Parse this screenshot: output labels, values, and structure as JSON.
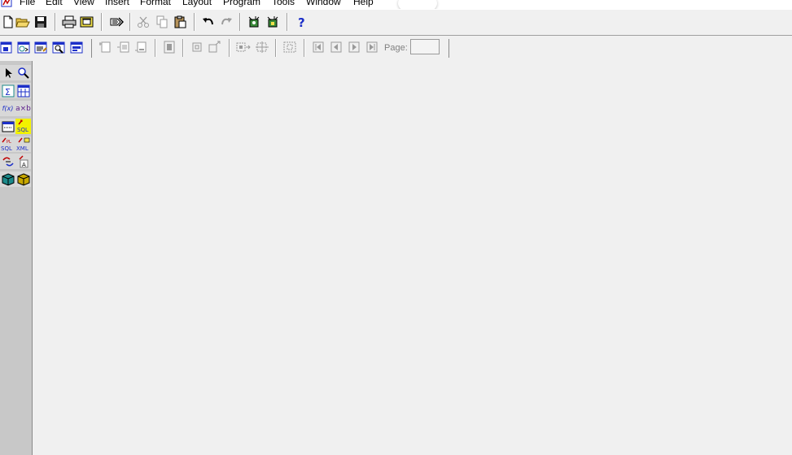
{
  "menubar": {
    "items": [
      "File",
      "Edit",
      "View",
      "Insert",
      "Format",
      "Layout",
      "Program",
      "Tools",
      "Window",
      "Help"
    ]
  },
  "toolbar_standard": {
    "buttons": [
      "new-document",
      "open",
      "save",
      "print",
      "print-preview",
      "run-report",
      "cut",
      "copy",
      "paste",
      "undo",
      "redo",
      "data-model-wizard",
      "report-wizard",
      "help"
    ]
  },
  "toolbar_report": {
    "page_label": "Page:",
    "page_value": ""
  },
  "palette": {
    "items": [
      {
        "name": "select-tool",
        "text": ""
      },
      {
        "name": "magnify-tool",
        "text": ""
      },
      {
        "name": "summary-column-tool",
        "text": "Σ"
      },
      {
        "name": "cross-product-tool",
        "text": ""
      },
      {
        "name": "formula-column-tool",
        "text": "f(x)"
      },
      {
        "name": "placeholder-column-tool",
        "text": "a×b"
      },
      {
        "name": "ref-cursor-query-tool",
        "text": ""
      },
      {
        "name": "sql-query-tool",
        "text": "SQL"
      },
      {
        "name": "plsql-query-tool",
        "text": "SQL"
      },
      {
        "name": "xml-query-tool",
        "text": "XML"
      },
      {
        "name": "data-link-tool",
        "text": ""
      },
      {
        "name": "text-query-tool",
        "text": "A"
      },
      {
        "name": "jdbc-query-tool",
        "text": ""
      },
      {
        "name": "express-query-tool",
        "text": ""
      }
    ],
    "selected": "sql-query-tool"
  },
  "colors": {
    "selected_tool": "#f2f200",
    "help_blue": "#1c2fc8",
    "sql_red": "#c00000",
    "sql_blue": "#1c2fc8"
  }
}
